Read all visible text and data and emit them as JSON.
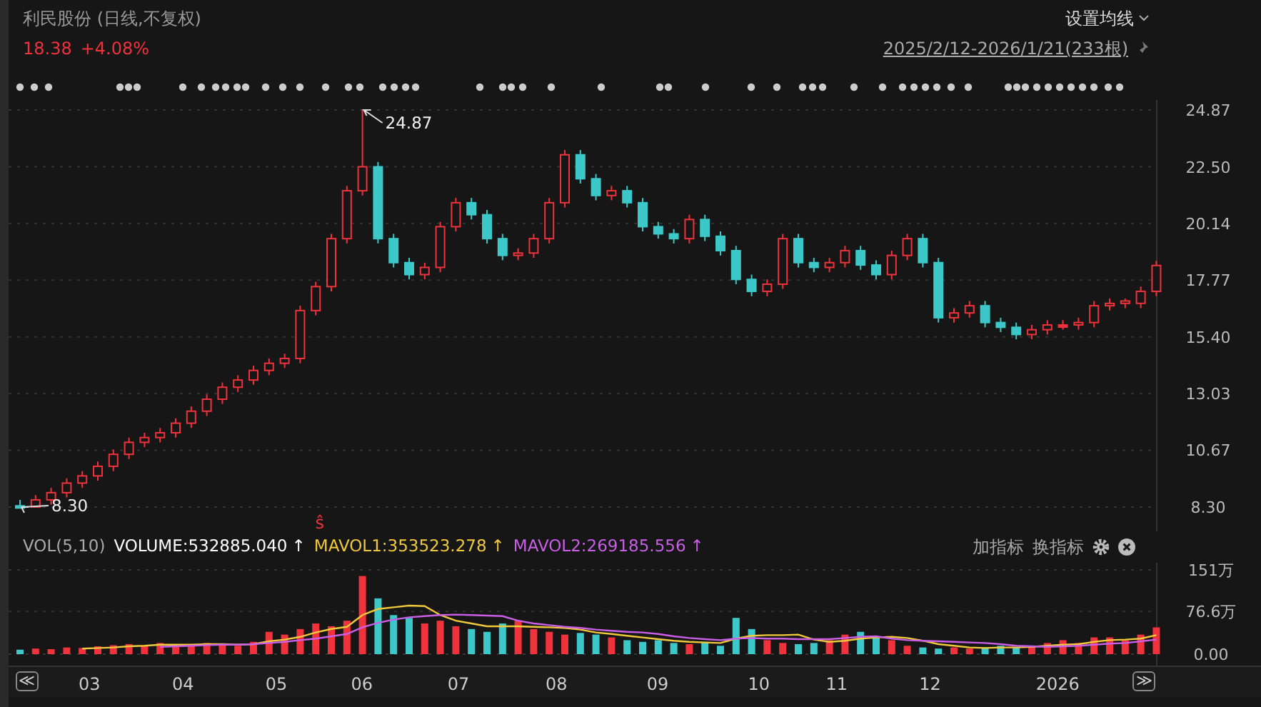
{
  "header": {
    "title": "利民股份 (日线,不复权)",
    "price": "18.38",
    "change": "+4.08%",
    "ma_button": "设置均线",
    "range_link": "2025/2/12-2026/1/21(233根)"
  },
  "price_chart": {
    "high_label": "24.87",
    "low_label": "8.30",
    "signal_mark": "ŝ",
    "chart_data": {
      "type": "candlestick",
      "ylim": [
        8.3,
        24.87
      ],
      "yticks": [
        {
          "value": 8.3,
          "label": "8.30"
        },
        {
          "value": 10.67,
          "label": "10.67"
        },
        {
          "value": 13.03,
          "label": "13.03"
        },
        {
          "value": 15.4,
          "label": "15.40"
        },
        {
          "value": 17.77,
          "label": "17.77"
        },
        {
          "value": 20.14,
          "label": "20.14"
        },
        {
          "value": 22.5,
          "label": "22.50"
        },
        {
          "value": 24.87,
          "label": "24.87"
        }
      ],
      "grid": true,
      "ohlc": [
        [
          8.35,
          8.6,
          8.3,
          8.3
        ],
        [
          8.3,
          8.8,
          8.3,
          8.6
        ],
        [
          8.6,
          9.1,
          8.4,
          8.9
        ],
        [
          8.9,
          9.5,
          8.7,
          9.3
        ],
        [
          9.3,
          9.8,
          9.1,
          9.6
        ],
        [
          9.6,
          10.2,
          9.4,
          10.0
        ],
        [
          10.0,
          10.7,
          9.8,
          10.5
        ],
        [
          10.5,
          11.2,
          10.3,
          11.0
        ],
        [
          11.0,
          11.4,
          10.8,
          11.2
        ],
        [
          11.2,
          11.6,
          11.0,
          11.4
        ],
        [
          11.4,
          12.0,
          11.2,
          11.8
        ],
        [
          11.8,
          12.5,
          11.6,
          12.3
        ],
        [
          12.3,
          13.0,
          12.1,
          12.8
        ],
        [
          12.8,
          13.5,
          12.6,
          13.3
        ],
        [
          13.3,
          13.8,
          13.1,
          13.6
        ],
        [
          13.6,
          14.2,
          13.4,
          14.0
        ],
        [
          14.0,
          14.5,
          13.8,
          14.3
        ],
        [
          14.3,
          14.7,
          14.1,
          14.5
        ],
        [
          14.5,
          16.7,
          14.3,
          16.5
        ],
        [
          16.5,
          17.7,
          16.3,
          17.5
        ],
        [
          17.5,
          19.7,
          17.3,
          19.5
        ],
        [
          19.5,
          21.7,
          19.3,
          21.5
        ],
        [
          21.5,
          24.87,
          21.3,
          22.5
        ],
        [
          22.5,
          22.7,
          19.3,
          19.5
        ],
        [
          19.5,
          19.7,
          18.3,
          18.5
        ],
        [
          18.5,
          18.7,
          17.8,
          18.0
        ],
        [
          18.0,
          18.5,
          17.8,
          18.3
        ],
        [
          18.3,
          20.2,
          18.1,
          20.0
        ],
        [
          20.0,
          21.2,
          19.8,
          21.0
        ],
        [
          21.0,
          21.2,
          20.3,
          20.5
        ],
        [
          20.5,
          20.7,
          19.3,
          19.5
        ],
        [
          19.5,
          19.7,
          18.6,
          18.8
        ],
        [
          18.8,
          19.1,
          18.6,
          18.9
        ],
        [
          18.9,
          19.7,
          18.7,
          19.5
        ],
        [
          19.5,
          21.2,
          19.3,
          21.0
        ],
        [
          21.0,
          23.2,
          20.8,
          23.0
        ],
        [
          23.0,
          23.2,
          21.8,
          22.0
        ],
        [
          22.0,
          22.2,
          21.1,
          21.3
        ],
        [
          21.3,
          21.7,
          21.1,
          21.5
        ],
        [
          21.5,
          21.7,
          20.8,
          21.0
        ],
        [
          21.0,
          21.2,
          19.8,
          20.0
        ],
        [
          20.0,
          20.2,
          19.5,
          19.7
        ],
        [
          19.7,
          19.9,
          19.3,
          19.5
        ],
        [
          19.5,
          20.5,
          19.3,
          20.3
        ],
        [
          20.3,
          20.5,
          19.4,
          19.6
        ],
        [
          19.6,
          19.8,
          18.8,
          19.0
        ],
        [
          19.0,
          19.2,
          17.6,
          17.8
        ],
        [
          17.8,
          18.0,
          17.1,
          17.3
        ],
        [
          17.3,
          17.8,
          17.1,
          17.6
        ],
        [
          17.6,
          19.7,
          17.4,
          19.5
        ],
        [
          19.5,
          19.7,
          18.3,
          18.5
        ],
        [
          18.5,
          18.7,
          18.1,
          18.3
        ],
        [
          18.3,
          18.7,
          18.1,
          18.5
        ],
        [
          18.5,
          19.2,
          18.3,
          19.0
        ],
        [
          19.0,
          19.2,
          18.2,
          18.4
        ],
        [
          18.4,
          18.6,
          17.8,
          18.0
        ],
        [
          18.0,
          19.0,
          17.8,
          18.8
        ],
        [
          18.8,
          19.7,
          18.6,
          19.5
        ],
        [
          19.5,
          19.7,
          18.3,
          18.5
        ],
        [
          18.5,
          18.7,
          16.0,
          16.2
        ],
        [
          16.2,
          16.6,
          16.0,
          16.4
        ],
        [
          16.4,
          16.9,
          16.2,
          16.7
        ],
        [
          16.7,
          16.9,
          15.8,
          16.0
        ],
        [
          16.0,
          16.2,
          15.6,
          15.8
        ],
        [
          15.8,
          16.0,
          15.3,
          15.5
        ],
        [
          15.5,
          15.9,
          15.3,
          15.7
        ],
        [
          15.7,
          16.1,
          15.5,
          15.9
        ],
        [
          15.9,
          16.1,
          15.7,
          15.9
        ],
        [
          15.9,
          16.2,
          15.7,
          16.0
        ],
        [
          16.0,
          16.9,
          15.8,
          16.7
        ],
        [
          16.7,
          17.0,
          16.5,
          16.8
        ],
        [
          16.8,
          17.0,
          16.6,
          16.9
        ],
        [
          16.8,
          17.5,
          16.6,
          17.3
        ],
        [
          17.3,
          18.58,
          17.1,
          18.38
        ]
      ]
    }
  },
  "volume_panel": {
    "name": "VOL(5,10)",
    "items": [
      {
        "text": "VOLUME:532885.040",
        "color": "#ffffff"
      },
      {
        "text": "MAVOL1:353523.278",
        "color": "#f0c93a"
      },
      {
        "text": "MAVOL2:269185.556",
        "color": "#c95fe6"
      }
    ],
    "arrow": "↑",
    "actions": [
      "加指标",
      "换指标"
    ],
    "chart_data": {
      "type": "bar",
      "ylim": [
        0,
        151
      ],
      "yticks": [
        {
          "value": 0,
          "label": "0.00"
        },
        {
          "value": 76.6,
          "label": "76.6万"
        },
        {
          "value": 151,
          "label": "151万"
        }
      ],
      "grid": true,
      "series": [
        {
          "colors": [
            "#3cc8c8",
            "#f0323c",
            "#f0323c",
            "#f0323c",
            "#f0323c",
            "#f0323c",
            "#f0323c",
            "#f0323c",
            "#f0323c",
            "#f0323c",
            "#f0323c",
            "#f0323c",
            "#f0323c",
            "#f0323c",
            "#f0323c",
            "#f0323c",
            "#f0323c",
            "#f0323c",
            "#f0323c",
            "#f0323c",
            "#f0323c",
            "#f0323c",
            "#f0323c",
            "#3cc8c8",
            "#3cc8c8",
            "#3cc8c8",
            "#f0323c",
            "#f0323c",
            "#f0323c",
            "#3cc8c8",
            "#3cc8c8",
            "#3cc8c8",
            "#f0323c",
            "#f0323c",
            "#f0323c",
            "#f0323c",
            "#3cc8c8",
            "#3cc8c8",
            "#f0323c",
            "#3cc8c8",
            "#3cc8c8",
            "#3cc8c8",
            "#3cc8c8",
            "#f0323c",
            "#3cc8c8",
            "#3cc8c8",
            "#3cc8c8",
            "#3cc8c8",
            "#f0323c",
            "#f0323c",
            "#3cc8c8",
            "#3cc8c8",
            "#f0323c",
            "#f0323c",
            "#3cc8c8",
            "#3cc8c8",
            "#f0323c",
            "#f0323c",
            "#3cc8c8",
            "#3cc8c8",
            "#f0323c",
            "#f0323c",
            "#3cc8c8",
            "#3cc8c8",
            "#3cc8c8",
            "#f0323c",
            "#f0323c",
            "#f0323c",
            "#f0323c",
            "#f0323c",
            "#f0323c",
            "#f0323c",
            "#f0323c",
            "#f0323c"
          ],
          "values": [
            8,
            10,
            9,
            12,
            11,
            14,
            16,
            18,
            15,
            20,
            18,
            16,
            20,
            17,
            15,
            22,
            40,
            35,
            45,
            55,
            50,
            60,
            140,
            100,
            70,
            65,
            55,
            60,
            50,
            45,
            40,
            55,
            60,
            45,
            40,
            35,
            38,
            35,
            30,
            25,
            22,
            25,
            20,
            18,
            22,
            15,
            65,
            45,
            25,
            20,
            18,
            20,
            25,
            35,
            40,
            30,
            25,
            15,
            12,
            10,
            12,
            10,
            12,
            15,
            12,
            14,
            20,
            25,
            20,
            30,
            30,
            25,
            35,
            48
          ]
        },
        {
          "type": "line",
          "color": "#f0c93a",
          "values": [
            null,
            null,
            null,
            null,
            10,
            11,
            12,
            14,
            15,
            17,
            17,
            17,
            18,
            18,
            17,
            18,
            23,
            26,
            31,
            39,
            45,
            49,
            70,
            81,
            84,
            87,
            86,
            70,
            60,
            55,
            50,
            50,
            50,
            49,
            48,
            47,
            44,
            39,
            36,
            33,
            30,
            27,
            24,
            22,
            21,
            20,
            28,
            33,
            34,
            34,
            35,
            26,
            22,
            24,
            28,
            30,
            31,
            29,
            24,
            18,
            15,
            12,
            11,
            12,
            12,
            13,
            15,
            17,
            18,
            22,
            25,
            26,
            28,
            34
          ]
        },
        {
          "type": "line",
          "color": "#c95fe6",
          "values": [
            null,
            null,
            null,
            null,
            null,
            null,
            null,
            null,
            null,
            13,
            14,
            15,
            16,
            17,
            17,
            18,
            20,
            22,
            25,
            28,
            32,
            36,
            48,
            56,
            62,
            66,
            68,
            70,
            71,
            70,
            69,
            68,
            60,
            55,
            52,
            49,
            47,
            44,
            42,
            40,
            39,
            36,
            32,
            29,
            27,
            25,
            28,
            29,
            28,
            28,
            27,
            27,
            27,
            29,
            31,
            32,
            28,
            25,
            24,
            23,
            22,
            21,
            20,
            18,
            15,
            14,
            13,
            14,
            15,
            17,
            19,
            20,
            23,
            26
          ]
        }
      ]
    }
  },
  "x_axis": {
    "prev": "≪",
    "next": "≫",
    "labels": [
      "03",
      "04",
      "05",
      "06",
      "07",
      "08",
      "09",
      "10",
      "11",
      "12",
      "2026"
    ]
  }
}
